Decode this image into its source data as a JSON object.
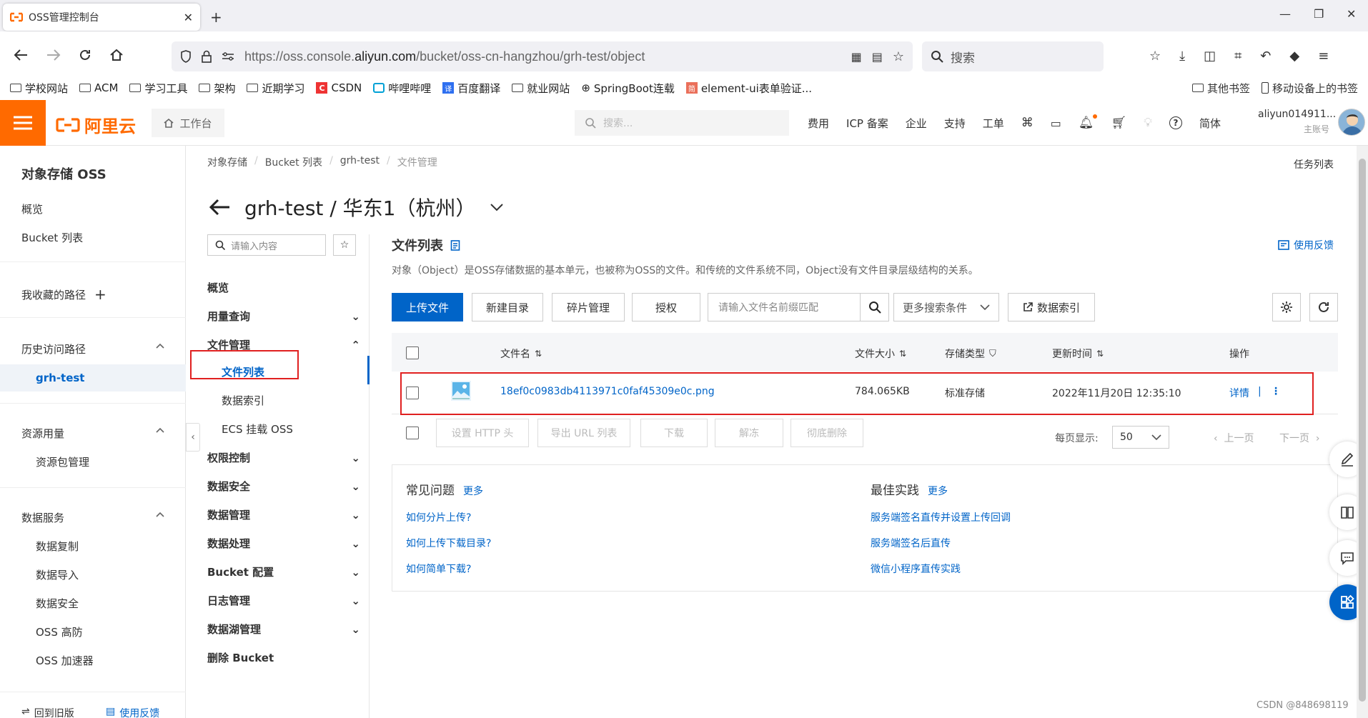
{
  "browser": {
    "tab_title": "OSS管理控制台",
    "url_prefix": "https://oss.console.",
    "url_domain": "aliyun.com",
    "url_suffix": "/bucket/oss-cn-hangzhou/grh-test/object",
    "search_placeholder": "搜索",
    "bookmarks": [
      "学校网站",
      "ACM",
      "学习工具",
      "架构",
      "近期学习",
      "CSDN",
      "哔哩哔哩",
      "百度翻译",
      "就业网站",
      "SpringBoot连载",
      "element-ui表单验证..."
    ],
    "bookmarks_right": [
      "其他书签",
      "移动设备上的书签"
    ]
  },
  "topbar": {
    "logo_text": "阿里云",
    "workbench": "工作台",
    "search_placeholder": "搜索...",
    "nav": [
      "费用",
      "ICP 备案",
      "企业",
      "支持",
      "工单"
    ],
    "lang": "简体",
    "account_name": "aliyun014911...",
    "account_sub": "主账号",
    "brand_color": "#ff6a00"
  },
  "sidebar": {
    "title": "对象存储 OSS",
    "items": [
      "概览",
      "Bucket 列表"
    ],
    "favorites": "我收藏的路径",
    "history": "历史访问路径",
    "history_item": "grh-test",
    "resource": "资源用量",
    "resource_items": [
      "资源包管理"
    ],
    "data_service": "数据服务",
    "data_items": [
      "数据复制",
      "数据导入",
      "数据安全",
      "OSS 高防",
      "OSS 加速器"
    ],
    "footer_left": "回到旧版",
    "footer_right": "使用反馈"
  },
  "breadcrumb": [
    "对象存储",
    "Bucket 列表",
    "grh-test",
    "文件管理"
  ],
  "task_list": "任务列表",
  "page_title": "grh-test / 华东1（杭州）",
  "mid_menu": {
    "search_placeholder": "请输入内容",
    "items": [
      {
        "label": "概览",
        "chevron": false
      },
      {
        "label": "用量查询",
        "chevron": true
      },
      {
        "label": "文件管理",
        "chevron": true,
        "open": true
      },
      {
        "label": "权限控制",
        "chevron": true
      },
      {
        "label": "数据安全",
        "chevron": true
      },
      {
        "label": "数据管理",
        "chevron": true
      },
      {
        "label": "数据处理",
        "chevron": true
      },
      {
        "label": "Bucket 配置",
        "chevron": true
      },
      {
        "label": "日志管理",
        "chevron": true
      },
      {
        "label": "数据湖管理",
        "chevron": true
      },
      {
        "label": "删除 Bucket",
        "chevron": false
      }
    ],
    "sub_items": [
      "文件列表",
      "数据索引",
      "ECS 挂载 OSS"
    ]
  },
  "main": {
    "title": "文件列表",
    "feedback": "使用反馈",
    "description": "对象（Object）是OSS存储数据的基本单元，也被称为OSS的文件。和传统的文件系统不同，Object没有文件目录层级结构的关系。",
    "buttons": {
      "upload": "上传文件",
      "mkdir": "新建目录",
      "fragments": "碎片管理",
      "authorize": "授权",
      "prefix_placeholder": "请输入文件名前缀匹配",
      "more_conditions": "更多搜索条件",
      "data_index": "数据索引"
    },
    "columns": {
      "name": "文件名",
      "size": "文件大小",
      "storage": "存储类型",
      "updated": "更新时间",
      "ops": "操作"
    },
    "rows": [
      {
        "name": "18ef0c0983db4113971c0faf45309e0c.png",
        "size": "784.065KB",
        "storage": "标准存储",
        "updated": "2022年11月20日 12:35:10",
        "detail": "详情"
      }
    ],
    "batch": [
      "设置 HTTP 头",
      "导出 URL 列表",
      "下载",
      "解冻",
      "彻底删除"
    ],
    "per_page_label": "每页显示:",
    "per_page": "50",
    "prev": "上一页",
    "next": "下一页",
    "faq": {
      "title": "常见问题",
      "more": "更多",
      "links": [
        "如何分片上传?",
        "如何上传下载目录?",
        "如何简单下载?"
      ]
    },
    "best": {
      "title": "最佳实践",
      "more": "更多",
      "links": [
        "服务端签名直传并设置上传回调",
        "服务端签名后直传",
        "微信小程序直传实践"
      ]
    }
  },
  "watermark": "CSDN @848698119",
  "accent_color": "#0064c8",
  "highlight_color": "#e02020"
}
